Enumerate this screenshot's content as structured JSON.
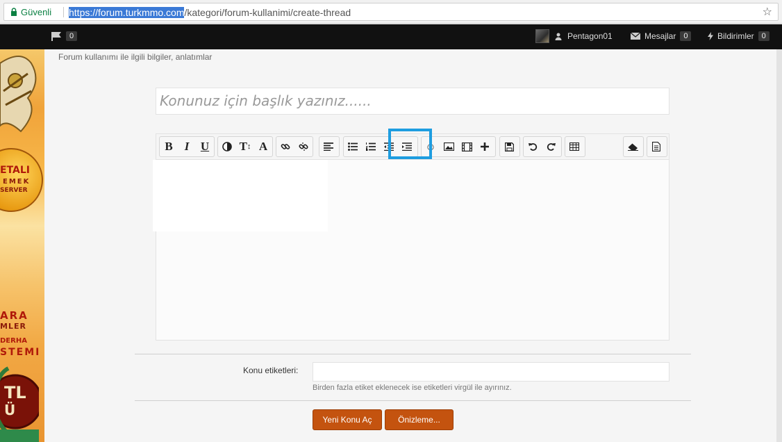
{
  "browser": {
    "secure_label": "Güvenli",
    "url_host": "https://forum.turkmmo.com",
    "url_path": "/kategori/forum-kullanimi/create-thread"
  },
  "topnav": {
    "flag_count": "0",
    "username": "Pentagon01",
    "messages_label": "Mesajlar",
    "messages_count": "0",
    "notifications_label": "Bildirimler",
    "notifications_count": "0"
  },
  "left_ad": {
    "lines": [
      "ETALI",
      "EMEK",
      "SERVER",
      "ARA",
      "MLER",
      "DERHA",
      "STEMI",
      "TL",
      "Ü"
    ]
  },
  "page": {
    "subtitle": "Forum kullanımı ile ilgili bilgiler, anlatımlar",
    "title_placeholder": "Konunuz için başlık yazınız......"
  },
  "toolbar": {
    "bold": "B",
    "italic": "I",
    "underline": "U",
    "font_size": "T",
    "font_color": "A"
  },
  "tags": {
    "label": "Konu etiketleri:",
    "hint": "Birden fazla etiket eklenecek ise etiketleri virgül ile ayırınız."
  },
  "actions": {
    "create_label": "Yeni Konu Aç",
    "preview_label": "Önizleme..."
  },
  "colors": {
    "accent": "#c4530f",
    "highlight_box": "#1e9de0",
    "secure_green": "#0b8043"
  }
}
